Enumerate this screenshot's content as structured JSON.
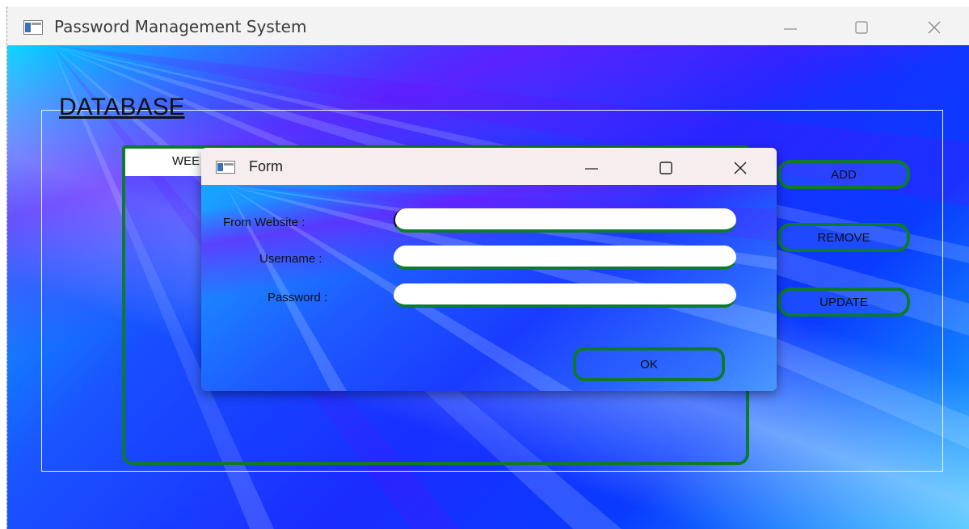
{
  "main_window": {
    "title": "Password Management System",
    "group_title": "DATABASE",
    "table_header_first_column": "WEE",
    "buttons": {
      "add": "ADD",
      "remove": "REMOVE",
      "update": "UPDATE"
    }
  },
  "dialog": {
    "title": "Form",
    "fields": [
      {
        "label": "From Website :",
        "value": ""
      },
      {
        "label": "Username :",
        "value": ""
      },
      {
        "label": "Password :",
        "value": ""
      }
    ],
    "ok_label": "OK"
  },
  "icons": {
    "app": "window-app-icon",
    "minimize": "minimize-icon",
    "maximize": "maximize-icon",
    "close": "close-icon"
  },
  "colors": {
    "accent_border": "#0e7a2c",
    "titlebar": "#f3f3f3",
    "dialog_titlebar": "#f6eeee"
  }
}
